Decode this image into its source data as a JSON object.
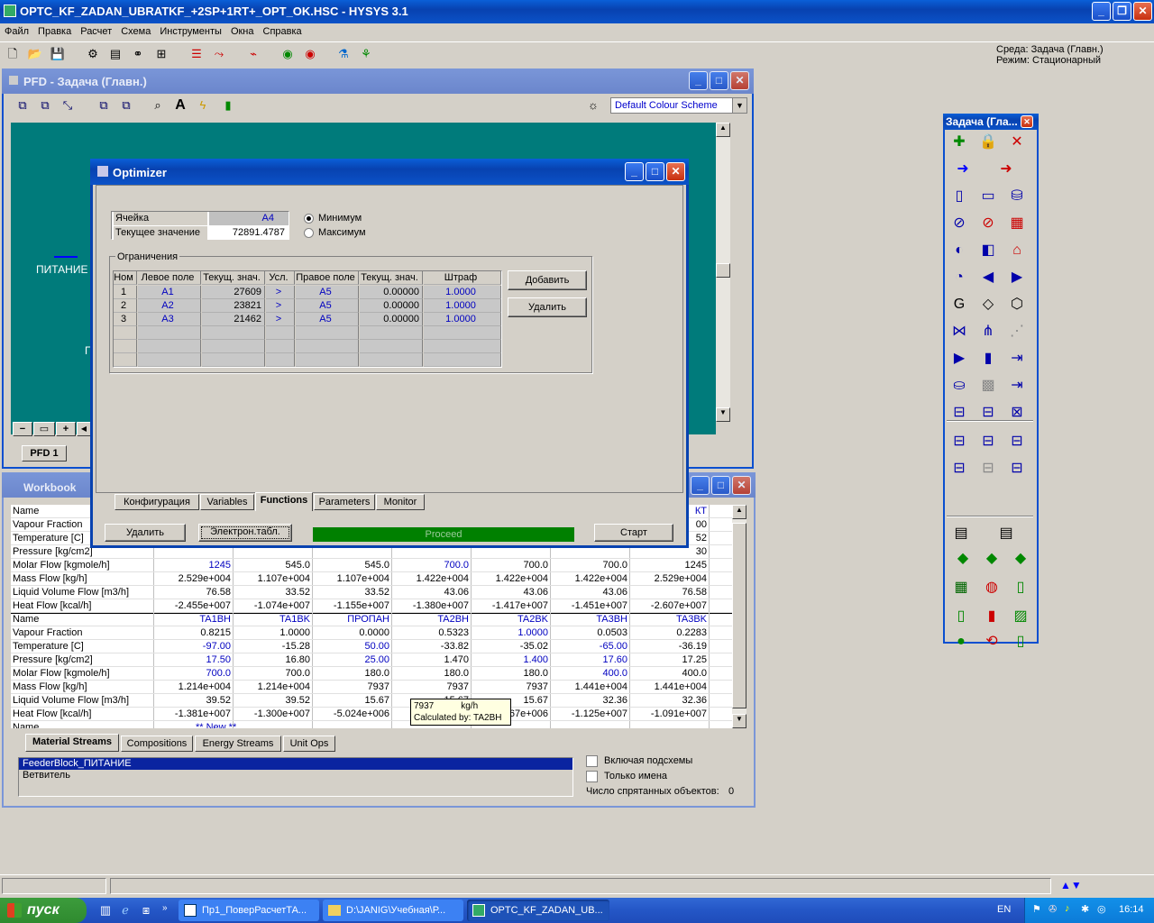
{
  "app": {
    "title": "OPTC_KF_ZADAN_UBRATKF_+2SP+1RT+_OPT_OK.HSC - HYSYS 3.1",
    "menu": [
      "Файл",
      "Правка",
      "Расчет",
      "Схема",
      "Инструменты",
      "Окна",
      "Справка"
    ],
    "env_line1": "Среда: Задача (Главн.)",
    "env_line2": "Режим: Стационарный"
  },
  "pfd": {
    "title": "PFD - Задача (Главн.)",
    "colour_scheme": "Default Colour Scheme",
    "label_feed": "ПИТАНИЕ",
    "label_p": "П",
    "tab": "PFD 1"
  },
  "optimizer": {
    "title": "Optimizer",
    "cell_label": "Ячейка",
    "cell_value": "A4",
    "current_label": "Текущее значение",
    "current_value": "72891.4787",
    "min_label": "Минимум",
    "max_label": "Максимум",
    "constraints_label": "Ограничения",
    "headers": [
      "Ном",
      "Левое поле",
      "Текущ. знач.",
      "Усл.",
      "Правое поле",
      "Текущ. знач.",
      "Штраф"
    ],
    "rows": [
      [
        "1",
        "A1",
        "27609",
        ">",
        "A5",
        "0.00000",
        "1.0000"
      ],
      [
        "2",
        "A2",
        "23821",
        ">",
        "A5",
        "0.00000",
        "1.0000"
      ],
      [
        "3",
        "A3",
        "21462",
        ">",
        "A5",
        "0.00000",
        "1.0000"
      ]
    ],
    "add": "Добавить",
    "delete_c": "Удалить",
    "tabs": [
      "Конфигурация",
      "Variables",
      "Functions",
      "Parameters",
      "Monitor"
    ],
    "btn_delete": "Удалить",
    "btn_sheet": "Электрон.табл.",
    "status": "Proceed",
    "btn_start": "Старт"
  },
  "workbook": {
    "title": "Workbook",
    "labels": [
      "Name",
      "Vapour Fraction",
      "Temperature [C]",
      "Pressure [kg/cm2]",
      "Molar Flow [kgmole/h]",
      "Mass Flow [kg/h]",
      "Liquid Volume Flow [m3/h]",
      "Heat Flow [kcal/h]"
    ],
    "top_partial": [
      [
        "",
        "",
        "",
        "",
        "",
        "",
        "",
        "КТ"
      ],
      [
        "",
        "",
        "",
        "",
        "",
        "",
        "",
        "00"
      ],
      [
        "",
        "",
        "",
        "",
        "",
        "",
        "",
        "52"
      ],
      [
        "",
        "",
        "",
        "",
        "",
        "",
        "",
        "30"
      ]
    ],
    "top": [
      [
        "1245",
        "545.0",
        "545.0",
        "700.0",
        "700.0",
        "700.0",
        "1245"
      ],
      [
        "2.529e+004",
        "1.107e+004",
        "1.107e+004",
        "1.422e+004",
        "1.422e+004",
        "1.422e+004",
        "2.529e+004"
      ],
      [
        "76.58",
        "33.52",
        "33.52",
        "43.06",
        "43.06",
        "43.06",
        "76.58"
      ],
      [
        "-2.455e+007",
        "-1.074e+007",
        "-1.155e+007",
        "-1.380e+007",
        "-1.417e+007",
        "-1.451e+007",
        "-2.607e+007"
      ]
    ],
    "bottom_names": [
      "TA1BH",
      "TA1BK",
      "ПРОПАН",
      "TA2BH",
      "TA2BK",
      "TA3BH",
      "TA3BK"
    ],
    "bottom": [
      [
        "0.8215",
        "1.0000",
        "0.0000",
        "0.5323",
        "1.0000",
        "0.0503",
        "0.2283"
      ],
      [
        "-97.00",
        "-15.28",
        "50.00",
        "-33.82",
        "-35.02",
        "-65.00",
        "-36.19"
      ],
      [
        "17.50",
        "16.80",
        "25.00",
        "1.470",
        "1.400",
        "17.60",
        "17.25"
      ],
      [
        "700.0",
        "700.0",
        "180.0",
        "180.0",
        "180.0",
        "400.0",
        "400.0"
      ],
      [
        "1.214e+004",
        "1.214e+004",
        "7937",
        "7937",
        "7937",
        "1.441e+004",
        "1.441e+004"
      ],
      [
        "39.52",
        "39.52",
        "15.67",
        "15.67",
        "15.67",
        "32.36",
        "32.36"
      ],
      [
        "-1.381e+007",
        "-1.300e+007",
        "-5.024e+006",
        "",
        "-5.67e+006",
        "-1.125e+007",
        "-1.091e+007"
      ]
    ],
    "new_label": "** New **",
    "tooltip_value": "7937",
    "tooltip_unit": "kg/h",
    "tooltip_calc": "Calculated by: TA2BH",
    "tabs": [
      "Material Streams",
      "Compositions",
      "Energy Streams",
      "Unit Ops"
    ],
    "list": [
      "FeederBlock_ПИТАНИЕ",
      "Ветвитель"
    ],
    "chk1": "Включая подсхемы",
    "chk2": "Только имена",
    "hidden_label": "Число спрятанных объектов:",
    "hidden_count": "0"
  },
  "palette": {
    "title": "Задача (Гла..."
  },
  "taskbar": {
    "start": "пуск",
    "tasks": [
      "Пр1_ПоверРасчетТА...",
      "D:\\JANIG\\Учебная\\Р...",
      "OPTC_KF_ZADAN_UB..."
    ],
    "lang": "EN",
    "time": "16:14"
  }
}
